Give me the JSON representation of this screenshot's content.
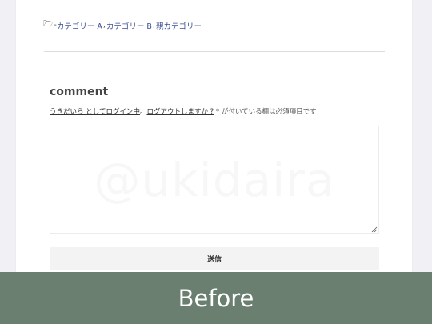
{
  "categories": {
    "folder_icon": "folder-icon",
    "prefix": "-",
    "items": [
      "カテゴリー A",
      "カテゴリー B",
      "親カテゴリー"
    ],
    "separator": ","
  },
  "comment": {
    "title": "comment",
    "logged_in_as": "うきだいら としてログイン中",
    "separator": "。",
    "logout_link": "ログアウトしますか ?",
    "required_note": "* が付いている欄は必須項目です",
    "textarea_value": "",
    "watermark": "@ukidaira",
    "submit_label": "送信"
  },
  "banner": {
    "label": "Before"
  },
  "colors": {
    "page_background": "#f1f0f4",
    "banner_background": "#6a7f70",
    "link": "#3a4f8f"
  }
}
